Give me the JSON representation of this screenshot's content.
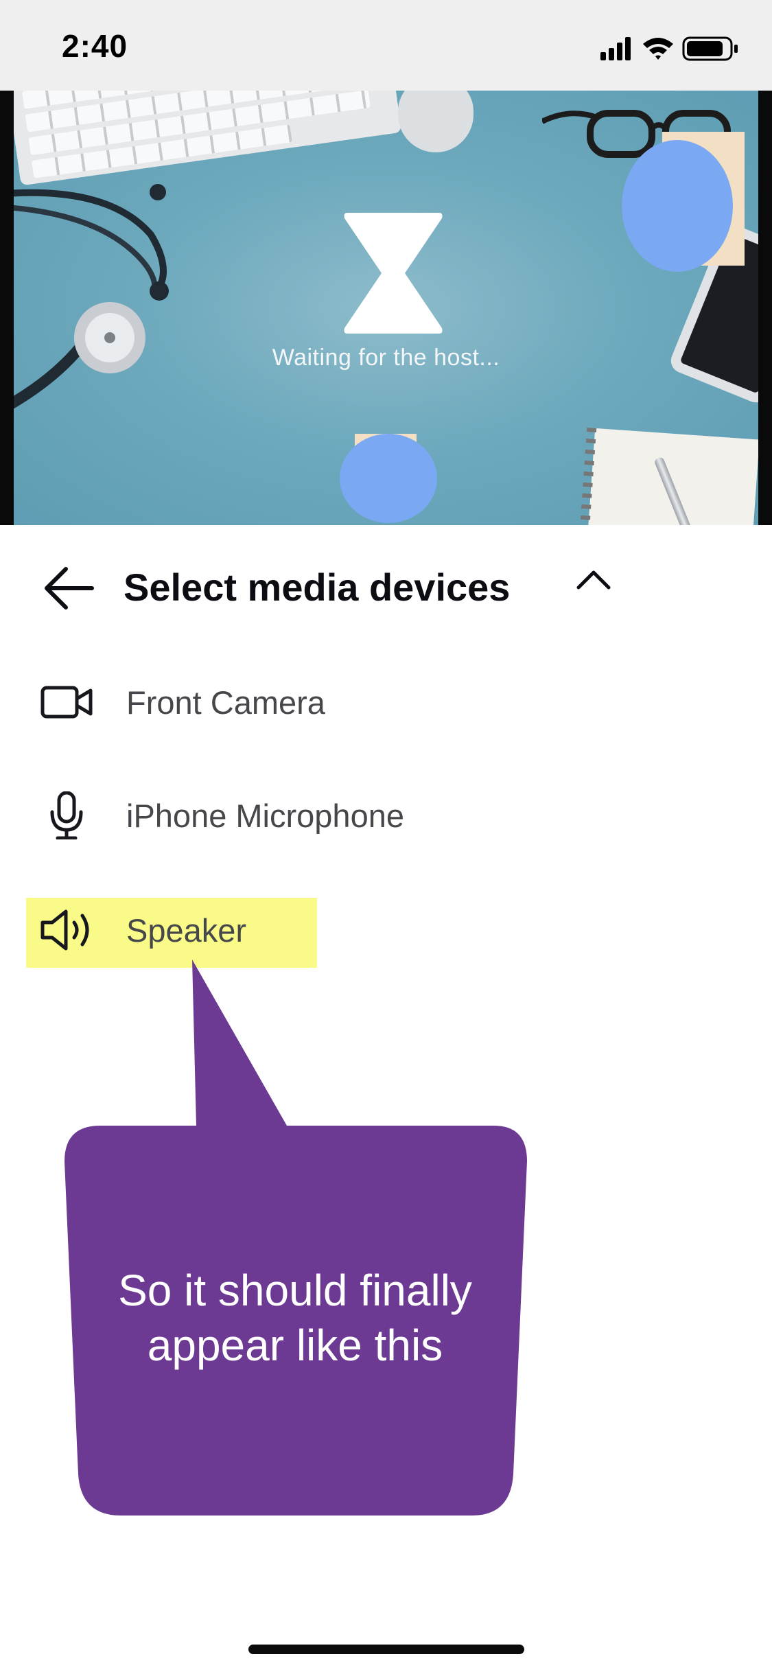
{
  "status_bar": {
    "time": "2:40",
    "icons": [
      "cellular-signal-icon",
      "wifi-icon",
      "battery-icon"
    ]
  },
  "video": {
    "waiting_text": "Waiting for the host...",
    "icon": "hourglass-icon",
    "background": "desk-photo-stethoscope-keyboard"
  },
  "panel": {
    "title": "Select media devices",
    "back_icon": "arrow-left-icon",
    "collapse_icon": "chevron-up-icon",
    "devices": [
      {
        "label": "Front Camera",
        "icon": "video-camera-icon"
      },
      {
        "label": "iPhone Microphone",
        "icon": "microphone-icon"
      },
      {
        "label": "Speaker",
        "icon": "speaker-icon",
        "highlighted": true
      }
    ]
  },
  "annotation": {
    "text_line1": "So it should finally",
    "text_line2": "appear like this",
    "color": "#6c3a93",
    "highlight_color": "#fafa88"
  },
  "colors": {
    "cover_blob": "#7aa8f2",
    "title": "#0b0d12",
    "device_label": "#45474b"
  }
}
